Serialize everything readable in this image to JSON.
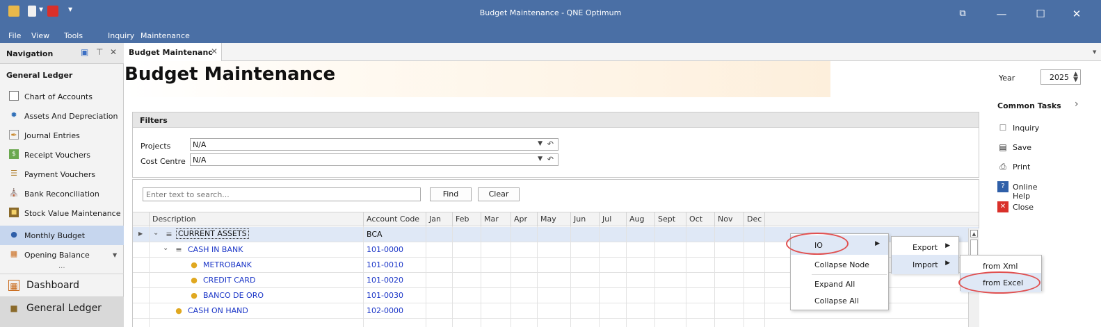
{
  "window": {
    "title": "Budget Maintenance - QNE Optimum",
    "controls": {
      "restore": "⧉",
      "minimize": "—",
      "maximize": "☐",
      "close": "✕"
    }
  },
  "menubar": [
    "File",
    "View",
    "Tools",
    "Inquiry",
    "Maintenance"
  ],
  "navigation": {
    "header": "Navigation",
    "section": "General Ledger",
    "items": [
      {
        "label": "Chart of Accounts",
        "icon": "book-icon"
      },
      {
        "label": "Assets And Depreciation",
        "icon": "gear-icon"
      },
      {
        "label": "Journal Entries",
        "icon": "pencil-icon"
      },
      {
        "label": "Receipt Vouchers",
        "icon": "receipt-icon"
      },
      {
        "label": "Payment Vouchers",
        "icon": "payment-icon"
      },
      {
        "label": "Bank Reconciliation",
        "icon": "bank-icon"
      },
      {
        "label": "Stock Value Maintenance",
        "icon": "stock-icon"
      },
      {
        "label": "Monthly Budget",
        "icon": "budget-icon"
      },
      {
        "label": "Opening Balance",
        "icon": "ledger-icon"
      }
    ],
    "more": "...",
    "bottom": [
      {
        "label": "Dashboard",
        "icon": "dashboard-icon"
      },
      {
        "label": "General Ledger",
        "icon": "general-ledger-icon"
      }
    ]
  },
  "tab": {
    "label": "Budget Maintenanc",
    "close": "✕"
  },
  "page": {
    "title": "Budget Maintenance"
  },
  "filters": {
    "title": "Filters",
    "projects_label": "Projects",
    "projects_value": "N/A",
    "cost_centre_label": "Cost Centre",
    "cost_centre_value": "N/A"
  },
  "search": {
    "placeholder": "Enter text to search...",
    "find": "Find",
    "clear": "Clear"
  },
  "grid": {
    "columns": [
      "Description",
      "Account Code",
      "Jan",
      "Feb",
      "Mar",
      "Apr",
      "May",
      "Jun",
      "Jul",
      "Aug",
      "Sept",
      "Oct",
      "Nov",
      "Dec"
    ],
    "rows": [
      {
        "description": "CURRENT ASSETS",
        "code": "BCA"
      },
      {
        "description": "CASH IN BANK",
        "code": "101-0000"
      },
      {
        "description": "METROBANK",
        "code": "101-0010"
      },
      {
        "description": "CREDIT CARD",
        "code": "101-0020"
      },
      {
        "description": "BANCO DE ORO",
        "code": "101-0030"
      },
      {
        "description": "CASH ON HAND",
        "code": "102-0000"
      }
    ]
  },
  "right_panel": {
    "year_label": "Year",
    "year_value": "2025",
    "common_tasks": "Common Tasks",
    "tasks": [
      {
        "label": "Inquiry",
        "icon": "inquiry-icon"
      },
      {
        "label": "Save",
        "icon": "save-icon"
      },
      {
        "label": "Print",
        "icon": "print-icon"
      },
      {
        "label": "Online Help",
        "icon": "help-icon"
      },
      {
        "label": "Close",
        "icon": "close-icon"
      }
    ]
  },
  "context_menu": {
    "items": [
      "IO",
      "Collapse Node",
      "Expand All",
      "Collapse All"
    ],
    "io_submenu": [
      "Export",
      "Import"
    ],
    "import_submenu": [
      "from Xml",
      "from Excel"
    ]
  },
  "colors": {
    "titlebar": "#4a6fa5",
    "highlight_ring": "#e05050",
    "link": "#1a35c7"
  }
}
